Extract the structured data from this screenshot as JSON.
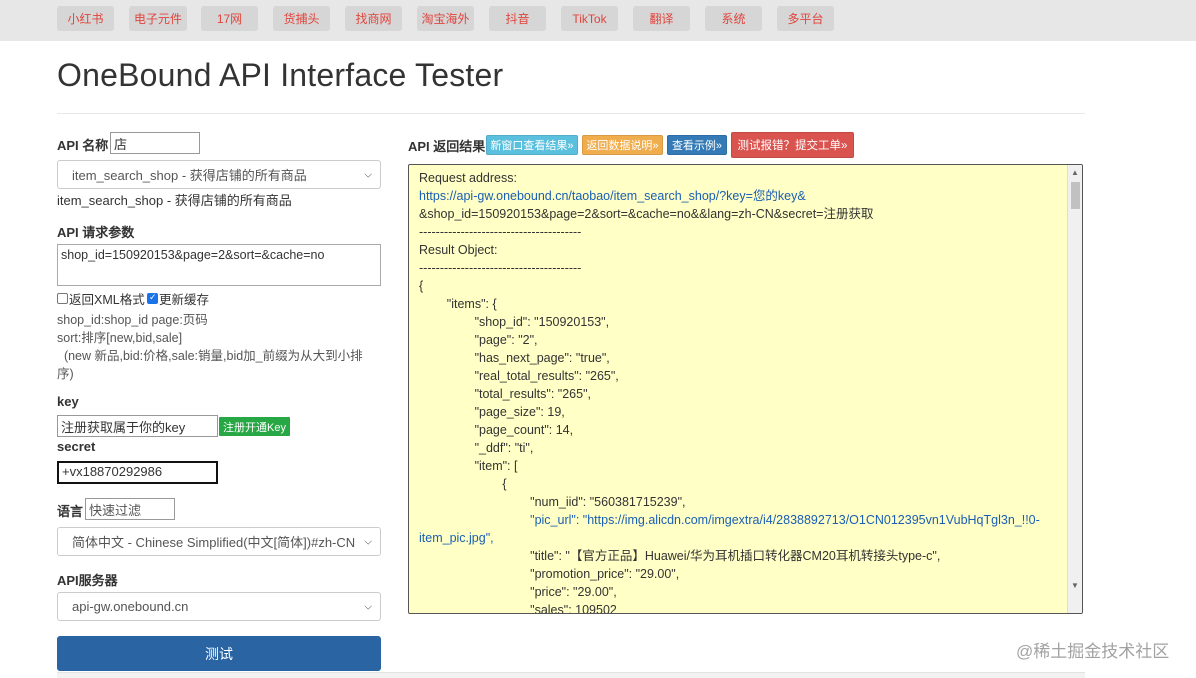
{
  "nav": [
    "小红书",
    "电子元件",
    "17网",
    "货捕头",
    "找商网",
    "淘宝海外",
    "抖音",
    "TikTok",
    "翻译",
    "系统",
    "多平台"
  ],
  "title": "OneBound API Interface Tester",
  "api_name": {
    "label": "API 名称",
    "value": "店",
    "selected": "item_search_shop - 获得店铺的所有商品",
    "desc": "item_search_shop - 获得店铺的所有商品"
  },
  "params": {
    "label": "API 请求参数",
    "value": "shop_id=150920153&page=2&sort=&cache=no",
    "xml_label": "返回XML格式",
    "cache_label": "更新缓存",
    "help": [
      "shop_id:shop_id page:页码",
      "sort:排序[new,bid,sale]",
      "  (new 新品,bid:价格,sale:销量,bid加_前缀为从大到小排",
      "序)"
    ]
  },
  "key": {
    "label": "key",
    "value": "注册获取属于你的key",
    "register": "注册开通Key"
  },
  "secret": {
    "label": "secret",
    "value": "+vx18870292986"
  },
  "lang": {
    "label": "语言",
    "placeholder": "快速过滤",
    "selected": "简体中文 - Chinese Simplified(中文[简体])#zh-CN"
  },
  "server": {
    "label": "API服务器",
    "selected": "api-gw.onebound.cn"
  },
  "test_button": "测试",
  "result": {
    "label": "API 返回结果",
    "buttons": [
      "新窗口查看结果»",
      "返回数据说明»",
      "查看示例»",
      "测试报错？提交工单»"
    ],
    "button_colors": [
      "#5bc0de",
      "#f0ad4e",
      "#337ab7",
      "#d9534f"
    ],
    "lines": [
      "Request address:",
      "https://api-gw.onebound.cn/taobao/item_search_shop/?key=您的key&",
      "&shop_id=150920153&page=2&sort=&cache=no&&lang=zh-CN&secret=注册获取",
      "---------------------------------------",
      "Result Object:",
      "---------------------------------------",
      "{",
      "        \"items\": {",
      "                \"shop_id\": \"150920153\",",
      "                \"page\": \"2\",",
      "                \"has_next_page\": \"true\",",
      "                \"real_total_results\": \"265\",",
      "                \"total_results\": \"265\",",
      "                \"page_size\": 19,",
      "                \"page_count\": 14,",
      "                \"_ddf\": \"ti\",",
      "                \"item\": [",
      "                        {",
      "                                \"num_iid\": \"560381715239\",",
      "                                \"pic_url\": \"https://img.alicdn.com/imgextra/i4/2838892713/O1CN012395vn1VubHqTgl3n_!!0-",
      "item_pic.jpg\",",
      "                                \"title\": \"【官方正品】Huawei/华为耳机插口转化器CM20耳机转接头type-c\",",
      "                                \"promotion_price\": \"29.00\",",
      "                                \"price\": \"29.00\",",
      "                                \"sales\": 109502"
    ]
  },
  "watermark": "@稀土掘金技术社区"
}
